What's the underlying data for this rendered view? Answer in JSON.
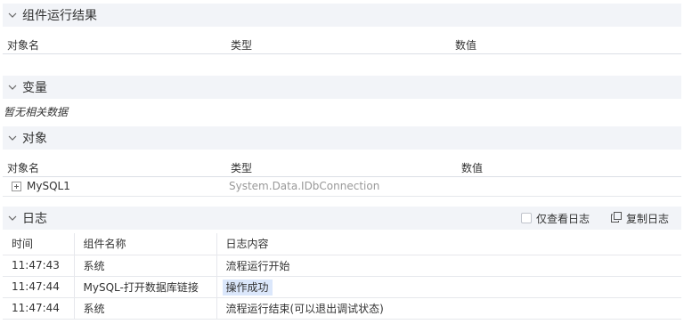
{
  "component_results": {
    "title": "组件运行结果",
    "columns": [
      "对象名",
      "类型",
      "数值"
    ]
  },
  "variables": {
    "title": "变量",
    "empty_text": "暂无相关数据"
  },
  "objects": {
    "title": "对象",
    "columns": [
      "对象名",
      "类型",
      "数值"
    ],
    "rows": [
      {
        "name": "MySQL1",
        "type": "System.Data.IDbConnection",
        "value": ""
      }
    ]
  },
  "log": {
    "title": "日志",
    "only_view_log_label": "仅查看日志",
    "copy_log_label": "复制日志",
    "columns": [
      "时间",
      "组件名称",
      "日志内容"
    ],
    "rows": [
      {
        "time": "11:47:43",
        "component": "系统",
        "content": "流程运行开始"
      },
      {
        "time": "11:47:44",
        "component": "MySQL-打开数据库链接",
        "content": "操作成功"
      },
      {
        "time": "11:47:44",
        "component": "系统",
        "content": "流程运行结束(可以退出调试状态)"
      }
    ]
  }
}
